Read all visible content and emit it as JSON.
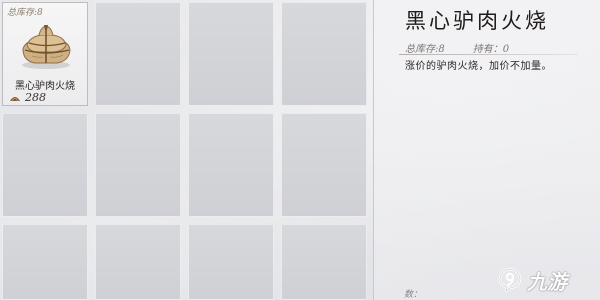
{
  "inventory": {
    "selected_item": {
      "stock_label": "总库存:8",
      "icon": "wrapped-bundle-icon",
      "name": "黑心驴肉火烧",
      "currency_icon": "coin-icon",
      "price": "288"
    },
    "empty_slot_count": 11
  },
  "detail": {
    "title": "黑心驴肉火烧",
    "total_stock": "总库存:8",
    "held": "持有：0",
    "description": "涨价的驴肉火烧，加价不加量。",
    "count_label": "数："
  },
  "watermark": {
    "text": "九游",
    "logo_icon": "9game-logo-icon"
  },
  "colors": {
    "selected_slot_bg": "#f3f3f4",
    "empty_slot_bg": "#d3d4d8",
    "title_text": "#1f1b1a",
    "meta_text": "#7e7674"
  }
}
